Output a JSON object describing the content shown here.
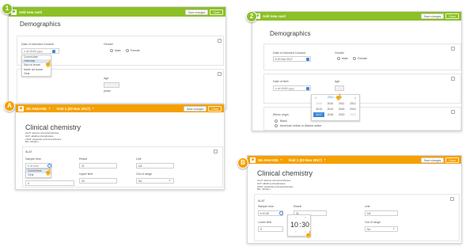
{
  "p1": {
    "badge": "1",
    "title": "Add new card",
    "save": "Save changes",
    "close": "Close",
    "heading": "Demographics",
    "consent_label": "Date of Informed Consent",
    "date_ph": "dd MMM yyyy",
    "gender_label": "Gender",
    "male": "Male",
    "female": "Female",
    "menu": [
      "Current date",
      "Yesterday",
      "Day not known",
      "Month not known",
      "Clear"
    ],
    "age_label": "Age",
    "years": "years"
  },
  "p2": {
    "badge": "2",
    "title": "Add new card",
    "save": "Save changes",
    "close": "Close",
    "heading": "Demographics",
    "consent_label": "Date of Informed Consent",
    "consent_value": "19 Nov 2017",
    "gender_label": "Gender",
    "male": "Male",
    "female": "Female",
    "dob_label": "Date of birth",
    "date_ph": "dd MMM yyyy",
    "age_label": "Age",
    "range": "2010 - 2019",
    "years": [
      "2009",
      "2010",
      "2011",
      "2012",
      "2013",
      "2014",
      "2015",
      "2016",
      "2017",
      "2018",
      "2019",
      "2020"
    ],
    "selected_year": "2017",
    "ethnic_label": "Ethnic origin",
    "black": "Black",
    "amer": "American Indian or Alaska native"
  },
  "pA": {
    "badge": "A",
    "site": "SE-AHU-025",
    "visit": "Visit 1 (20 Nov 2017)",
    "save": "Save changes",
    "close": "Close",
    "heading": "Clinical chemistry",
    "desc": [
      "ALAT: alanine aminotransferase",
      "ALP: alkaline phosphatase",
      "ASAT: aspartate aminotransferase",
      "BIL: bilirubin"
    ],
    "sec": "ALAT",
    "sample_label": "Sample time",
    "time_ph": "HH:mm",
    "menu": [
      "Current time",
      "Clear"
    ],
    "result_label": "Result",
    "result_value": "21",
    "unit_label": "Unit",
    "unit_value": "U/L",
    "lower_value": "0",
    "upper_label": "Upper limit",
    "upper_value": "44",
    "oor_label": "Out of range",
    "oor_value": "No"
  },
  "pB": {
    "badge": "B",
    "site": "SE-AHU-025",
    "visit": "Visit 1 (20 Nov 2017)",
    "save": "Save changes",
    "close": "Close",
    "heading": "Clinical chemistry",
    "desc": [
      "ALAT: alanine aminotransferase",
      "ALP: alkaline phosphatase",
      "ASAT: aspartate aminotransferase",
      "BIL: bilirubin"
    ],
    "sec": "ALAT",
    "sample_label": "Sample time",
    "time_value": "10:30",
    "result_label": "Result",
    "result_value": "21",
    "unit_label": "Unit",
    "unit_value": "U/L",
    "lower_label": "Lower limit",
    "lower_value": "0",
    "oor_label": "Out of range",
    "oor_value": "No",
    "hour": "10",
    "minute": "30"
  }
}
